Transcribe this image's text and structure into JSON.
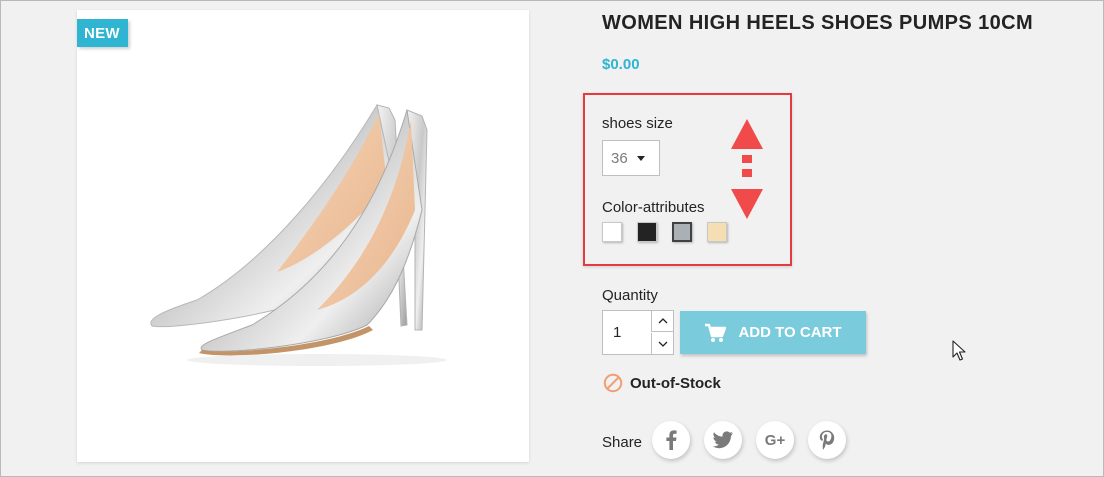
{
  "product": {
    "badge": "NEW",
    "title": "WOMEN HIGH HEELS SHOES PUMPS 10CM",
    "price": "$0.00"
  },
  "variants": {
    "size_label": "shoes size",
    "size_value": "36",
    "color_label": "Color-attributes",
    "colors": [
      {
        "name": "white",
        "hex": "#ffffff",
        "selected": false
      },
      {
        "name": "black",
        "hex": "#232323",
        "selected": false
      },
      {
        "name": "grey",
        "hex": "#aab0b3",
        "selected": true
      },
      {
        "name": "beige",
        "hex": "#f5deb3",
        "selected": false
      }
    ]
  },
  "cart": {
    "quantity_label": "Quantity",
    "quantity_value": "1",
    "add_to_cart_label": "ADD TO CART"
  },
  "availability": {
    "status": "Out-of-Stock"
  },
  "share": {
    "label": "Share",
    "networks": [
      {
        "name": "facebook",
        "glyph": "f"
      },
      {
        "name": "twitter",
        "glyph": "t"
      },
      {
        "name": "google-plus",
        "glyph": "G+"
      },
      {
        "name": "pinterest",
        "glyph": "P"
      }
    ]
  },
  "colors": {
    "accent": "#2fb5d2",
    "cart_button": "#7acbdc",
    "annotation": "#e53a40",
    "out_of_stock": "#f39d72"
  }
}
